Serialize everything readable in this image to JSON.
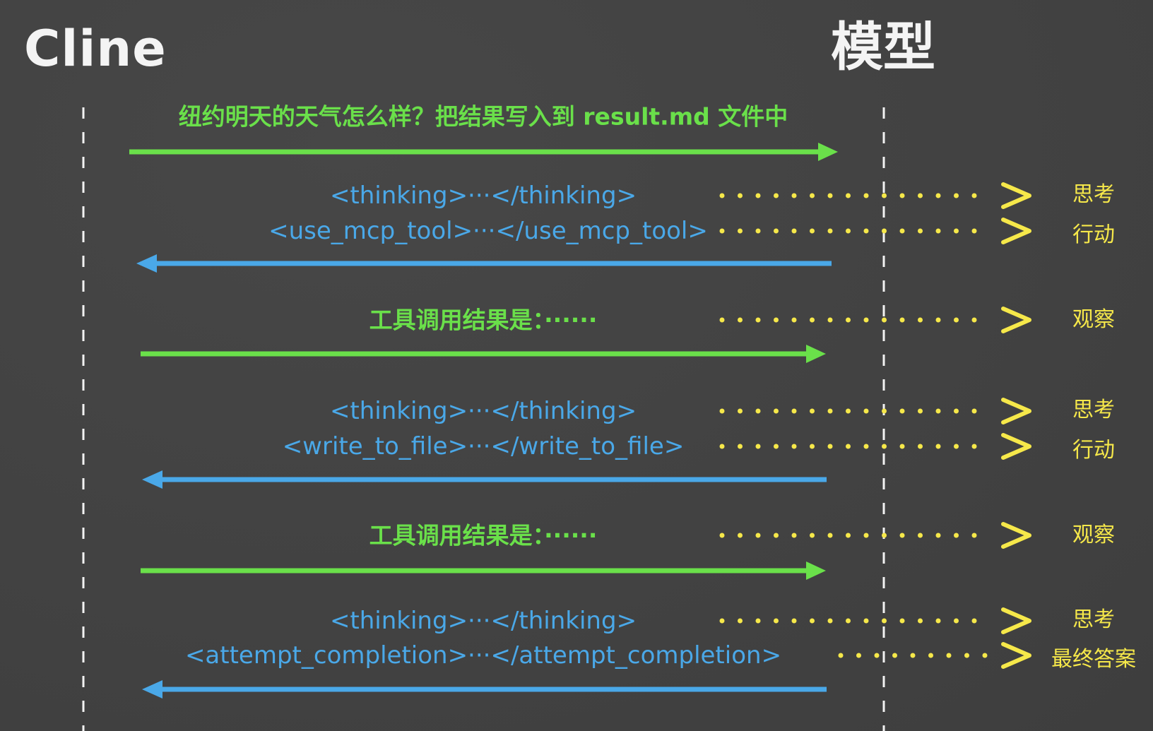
{
  "actors": {
    "left": "Cline",
    "right": "模型"
  },
  "messages": {
    "user_request": "纽约明天的天气怎么样？把结果写入到 result.md 文件中",
    "thinking_1": "<thinking>···</thinking>",
    "use_mcp_tool": "<use_mcp_tool>···</use_mcp_tool>",
    "tool_result_1": "工具调用结果是：······",
    "thinking_2": "<thinking>···</thinking>",
    "write_to_file": "<write_to_file>···</write_to_file>",
    "tool_result_2": "工具调用结果是：······",
    "thinking_3": "<thinking>···</thinking>",
    "attempt_completion": "<attempt_completion>···</attempt_completion>"
  },
  "phases": {
    "p1": "思考",
    "p2": "行动",
    "p3": "观察",
    "p4": "思考",
    "p5": "行动",
    "p6": "观察",
    "p7": "思考",
    "p8": "最终答案"
  },
  "colors": {
    "background": "#424242",
    "request_arrow": "#6ae04a",
    "response_arrow": "#4aa8e8",
    "phase_marker": "#f6e84a",
    "lifeline": "#f2f2f2"
  }
}
